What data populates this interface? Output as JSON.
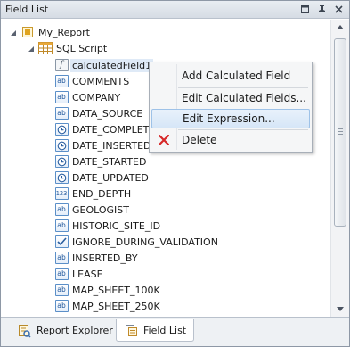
{
  "panel": {
    "title": "Field List"
  },
  "tree": {
    "root": {
      "label": "My_Report",
      "icon": "report-icon"
    },
    "datasource": {
      "label": "SQL Script",
      "icon": "table-icon"
    },
    "fields": [
      {
        "label": "calculatedField1",
        "icon": "fx-icon",
        "glyph": "f",
        "selected": true
      },
      {
        "label": "COMMENTS",
        "icon": "string-field-icon",
        "glyph": "ab"
      },
      {
        "label": "COMPANY",
        "icon": "string-field-icon",
        "glyph": "ab"
      },
      {
        "label": "DATA_SOURCE",
        "icon": "string-field-icon",
        "glyph": "ab"
      },
      {
        "label": "DATE_COMPLETED",
        "icon": "date-field-icon",
        "glyph": "clock"
      },
      {
        "label": "DATE_INSERTED",
        "icon": "date-field-icon",
        "glyph": "clock"
      },
      {
        "label": "DATE_STARTED",
        "icon": "date-field-icon",
        "glyph": "clock"
      },
      {
        "label": "DATE_UPDATED",
        "icon": "date-field-icon",
        "glyph": "clock"
      },
      {
        "label": "END_DEPTH",
        "icon": "number-field-icon",
        "glyph": "123"
      },
      {
        "label": "GEOLOGIST",
        "icon": "string-field-icon",
        "glyph": "ab"
      },
      {
        "label": "HISTORIC_SITE_ID",
        "icon": "string-field-icon",
        "glyph": "ab"
      },
      {
        "label": "IGNORE_DURING_VALIDATION",
        "icon": "boolean-field-icon",
        "glyph": "check"
      },
      {
        "label": "INSERTED_BY",
        "icon": "string-field-icon",
        "glyph": "ab"
      },
      {
        "label": "LEASE",
        "icon": "string-field-icon",
        "glyph": "ab"
      },
      {
        "label": "MAP_SHEET_100K",
        "icon": "string-field-icon",
        "glyph": "ab"
      },
      {
        "label": "MAP_SHEET_250K",
        "icon": "string-field-icon",
        "glyph": "ab"
      }
    ]
  },
  "context_menu": {
    "items": [
      {
        "label": "Add Calculated Field",
        "icon": ""
      },
      {
        "label": "Edit Calculated Fields...",
        "icon": ""
      },
      {
        "label": "Edit Expression...",
        "icon": "",
        "highlighted": true
      },
      {
        "label": "Delete",
        "icon": "delete-icon"
      }
    ]
  },
  "tabs": [
    {
      "label": "Report Explorer",
      "icon": "report-explorer-icon",
      "active": false
    },
    {
      "label": "Field List",
      "icon": "field-list-icon",
      "active": true
    }
  ],
  "colors": {
    "accent": "#5b8fc8",
    "delete": "#d62828",
    "highlight": "#d6e6f7"
  }
}
